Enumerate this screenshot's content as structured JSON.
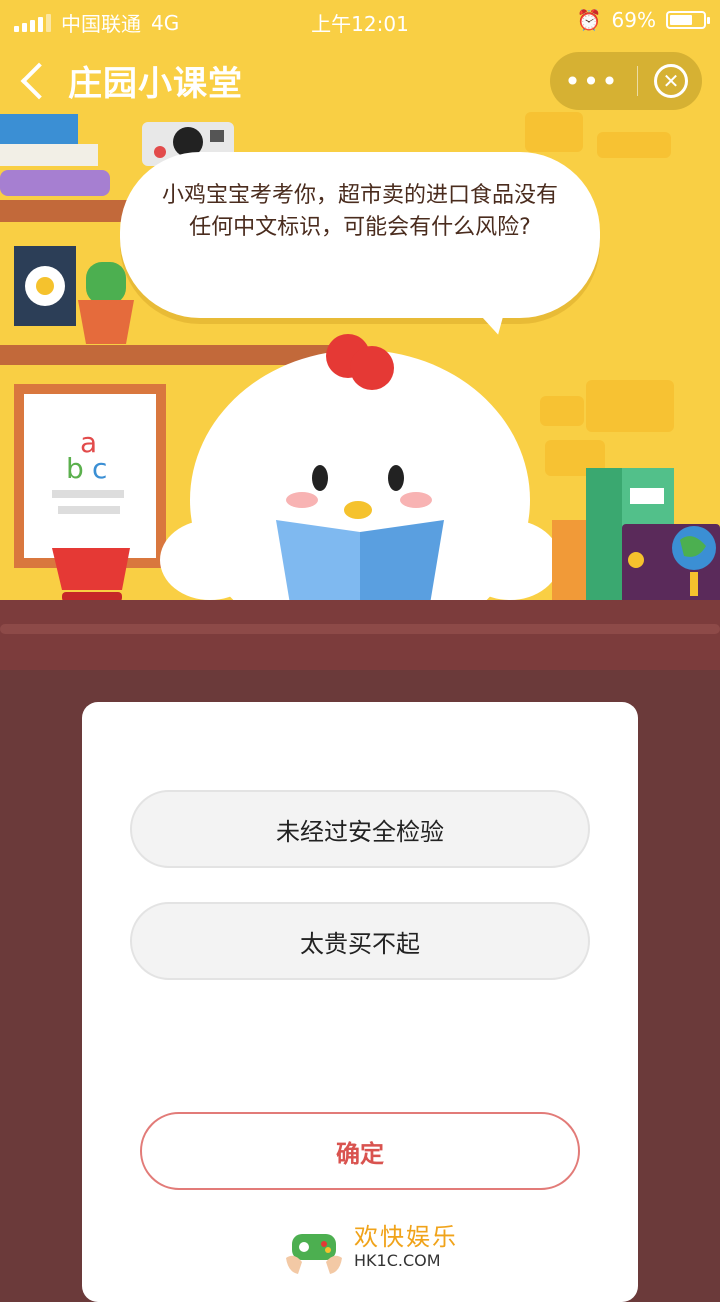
{
  "status": {
    "carrier": "中国联通",
    "network": "4G",
    "time": "上午12:01",
    "battery": "69%",
    "battery_level": 0.69
  },
  "header": {
    "back_icon": "chevron-left-icon",
    "title": "庄园小课堂",
    "more_label": "•••",
    "close_icon": "close-circle-icon"
  },
  "question": {
    "text": "小鸡宝宝考考你，超市卖的进口食品没有任何中文标识，可能会有什么风险?"
  },
  "options": [
    {
      "label": "未经过安全检验"
    },
    {
      "label": "太贵买不起"
    }
  ],
  "confirm_label": "确定",
  "brand": {
    "cn": "欢快娱乐",
    "en": "HK1C.COM"
  },
  "colors": {
    "scene_bg": "#f9cf44",
    "desk": "#7c3c3c",
    "wall": "#6b3a3a",
    "confirm": "#d9534f"
  }
}
